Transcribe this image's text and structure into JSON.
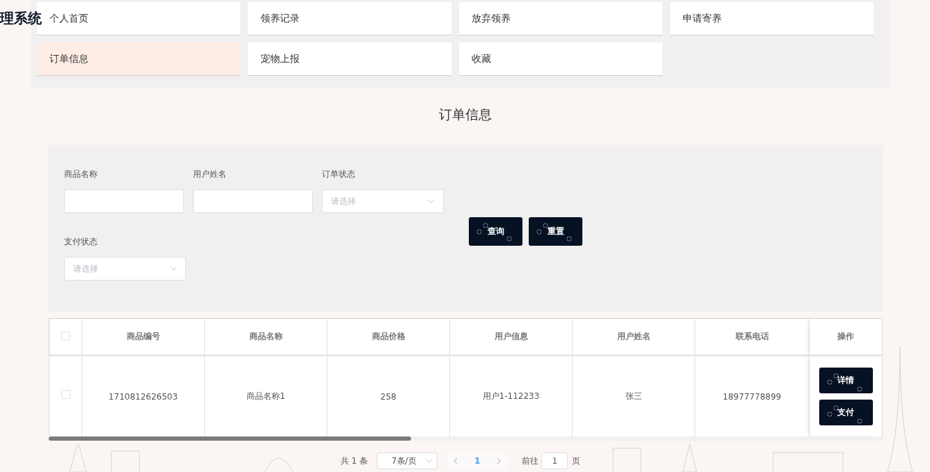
{
  "header": {
    "title": "理系统"
  },
  "nav": [
    {
      "label": "个人首页",
      "selected": false
    },
    {
      "label": "领养记录",
      "selected": false
    },
    {
      "label": "放弃领养",
      "selected": false
    },
    {
      "label": "申请寄养",
      "selected": false
    },
    {
      "label": "订单信息",
      "selected": true
    },
    {
      "label": "宠物上报",
      "selected": false
    },
    {
      "label": "收藏",
      "selected": false
    }
  ],
  "page_title": "订单信息",
  "filters": [
    {
      "kind": "text",
      "label": "商品名称"
    },
    {
      "kind": "text",
      "label": "用户姓名"
    },
    {
      "kind": "select",
      "label": "订单状态",
      "placeholder": "请选择"
    },
    {
      "kind": "select",
      "label": "支付状态",
      "placeholder": "请选择"
    }
  ],
  "buttons": [
    "查询",
    "重置"
  ],
  "table": {
    "all_checked": false,
    "columns": [
      "商品编号",
      "商品名称",
      "商品价格",
      "用户信息",
      "用户姓名",
      "联系电话",
      "操作"
    ],
    "rows": [
      {
        "checked": false,
        "cells": [
          "1710812626503",
          "商品名称1",
          "258",
          "用户1-112233",
          "张三",
          "18977778899"
        ],
        "actions": [
          "详情",
          "支付"
        ]
      }
    ]
  },
  "pagination": {
    "total": "共 1 条",
    "page_size": "7条/页",
    "pages": [
      {
        "label": "1",
        "selected": true
      }
    ],
    "goto_label": "前往",
    "goto_value": "1",
    "page_suffix": "页"
  }
}
